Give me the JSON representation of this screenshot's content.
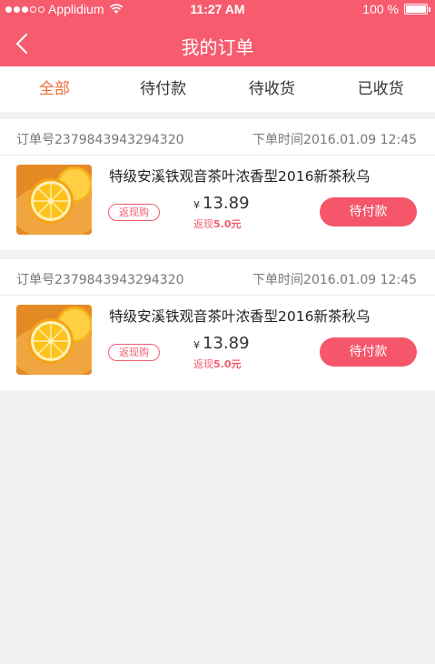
{
  "status_bar": {
    "carrier": "Applidium",
    "time": "11:27 AM",
    "battery": "100 %"
  },
  "header": {
    "title": "我的订单"
  },
  "tabs": [
    {
      "label": "全部",
      "active": true
    },
    {
      "label": "待付款"
    },
    {
      "label": "待收货"
    },
    {
      "label": "已收货"
    }
  ],
  "orders": [
    {
      "order_no": "订单号2379843943294320",
      "order_time": "下单时间2016.01.09 12:45",
      "product_name": "特级安溪铁观音茶叶浓香型2016新茶秋乌",
      "tag": "返现购",
      "currency": "¥",
      "price": "13.89",
      "cashback_label": "返现",
      "cashback_value": "5.0元",
      "action": "待付款"
    },
    {
      "order_no": "订单号2379843943294320",
      "order_time": "下单时间2016.01.09 12:45",
      "product_name": "特级安溪铁观音茶叶浓香型2016新茶秋乌",
      "tag": "返现购",
      "currency": "¥",
      "price": "13.89",
      "cashback_label": "返现",
      "cashback_value": "5.0元",
      "action": "待付款"
    }
  ],
  "colors": {
    "brand": "#f65b6e",
    "active_tab": "#f26a37",
    "button": "#f5566a"
  }
}
